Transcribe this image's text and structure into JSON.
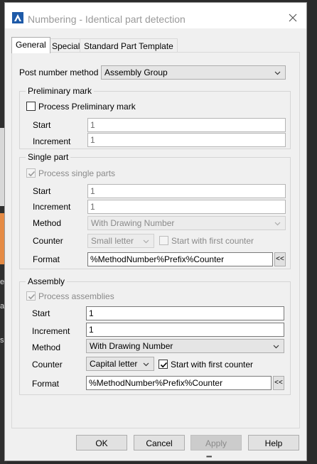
{
  "window": {
    "title": "Numbering - Identical part detection"
  },
  "tabs": [
    {
      "label": "General",
      "active": true
    },
    {
      "label": "Special",
      "active": false
    },
    {
      "label": "Standard Part Template",
      "active": false
    }
  ],
  "post_number_method": {
    "label": "Post number method",
    "value": "Assembly Group"
  },
  "preliminary_mark": {
    "legend": "Preliminary mark",
    "process_label": "Process Preliminary mark",
    "process_checked": false,
    "start_label": "Start",
    "start_value": "1",
    "increment_label": "Increment",
    "increment_value": "1"
  },
  "single_part": {
    "legend": "Single part",
    "process_label": "Process single parts",
    "process_checked": true,
    "start_label": "Start",
    "start_value": "1",
    "increment_label": "Increment",
    "increment_value": "1",
    "method_label": "Method",
    "method_value": "With Drawing Number",
    "counter_label": "Counter",
    "counter_value": "Small letter",
    "start_first_label": "Start with first counter",
    "start_first_checked": false,
    "format_label": "Format",
    "format_value": "%MethodNumber%Prefix%Counter",
    "format_button": "<<"
  },
  "assembly": {
    "legend": "Assembly",
    "process_label": "Process assemblies",
    "process_checked": true,
    "start_label": "Start",
    "start_value": "1",
    "increment_label": "Increment",
    "increment_value": "1",
    "method_label": "Method",
    "method_value": "With Drawing Number",
    "counter_label": "Counter",
    "counter_value": "Capital letter",
    "start_first_label": "Start with first counter",
    "start_first_checked": true,
    "format_label": "Format",
    "format_value": "%MethodNumber%Prefix%Counter",
    "format_button": "<<"
  },
  "buttons": {
    "ok": "OK",
    "cancel": "Cancel",
    "apply": "Apply",
    "help": "Help"
  },
  "background_fragments": [
    "e",
    "ar",
    "s"
  ]
}
